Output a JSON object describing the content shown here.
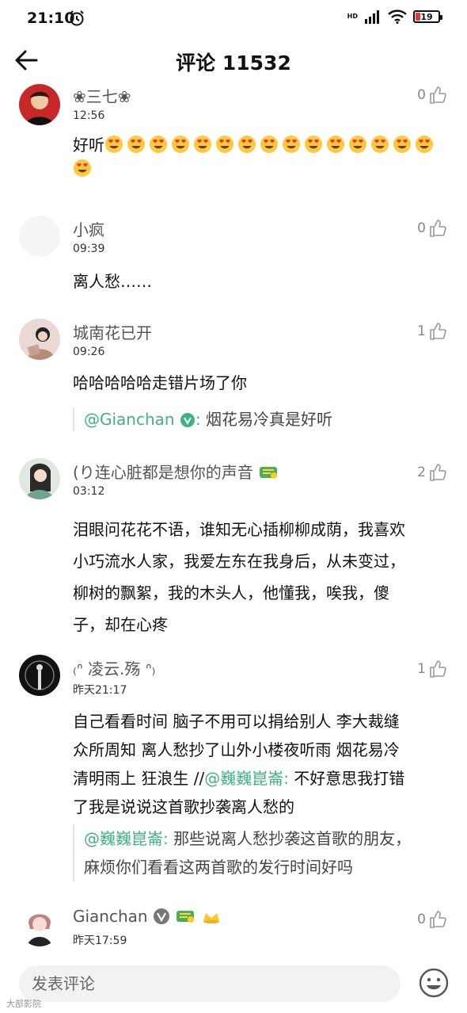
{
  "status": {
    "time": "21:10",
    "battery": "19",
    "battery_percent": 19,
    "hd": "HD"
  },
  "header": {
    "title": "评论 11532"
  },
  "comments": [
    {
      "user": "❀三七❀",
      "time": "12:56",
      "likes": "0",
      "text": "好听",
      "emoji_count": 16
    },
    {
      "user": "小疯",
      "time": "09:39",
      "likes": "0",
      "text": "离人愁……"
    },
    {
      "user": "城南花已开",
      "time": "09:26",
      "likes": "1",
      "text": "哈哈哈哈哈走错片场了你",
      "reply": {
        "at": "@Gianchan",
        "sep": ":",
        "text": " 烟花易冷真是好听"
      }
    },
    {
      "user": "(り连心脏都是想你的声音",
      "time": "03:12",
      "likes": "2",
      "lines": [
        "泪眼问花花不语，谁知无心插柳柳成荫，我喜欢",
        "小巧流水人家，我爱左东在我身后，从未变过，",
        "柳树的飘絮，我的木头人，他懂我，唉我，傻",
        "子，却在心疼"
      ]
    },
    {
      "user": "₍ᐢ 凌云.殇 ᐢ₎",
      "time": "昨天21:17",
      "likes": "1",
      "lines": [
        "自己看看时间 脑子不用可以捐给别人 李大裁缝",
        "众所周知 离人愁抄了山外小楼夜听雨 烟花易冷",
        "清明雨上 狂浪生 //"
      ],
      "line3_at": "@巍巍崑崙:",
      "line3_rest": " 不好意思我打错",
      "line4": "了我是说说这首歌抄袭离人愁的",
      "reply": {
        "at": "@巍巍崑崙:",
        "text1": " 那些说离人愁抄袭这首歌的朋友，",
        "text2": "麻烦你们看看这两首歌的发行时间好吗"
      }
    },
    {
      "user": "Gianchan",
      "time": "昨天17:59",
      "likes": "0"
    }
  ],
  "bottom": {
    "placeholder": "发表评论"
  },
  "watermark": "大部影院"
}
